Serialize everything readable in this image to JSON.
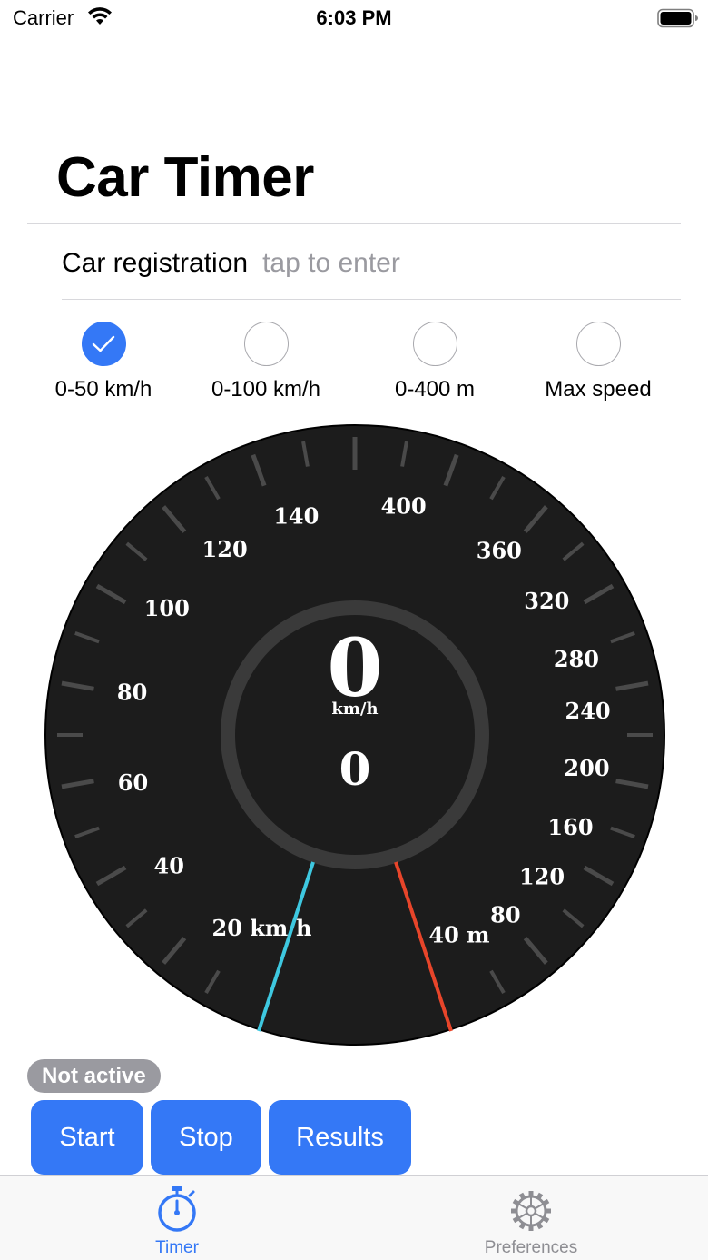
{
  "status_bar": {
    "carrier": "Carrier",
    "time": "6:03 PM"
  },
  "header": {
    "title": "Car Timer"
  },
  "registration": {
    "label": "Car registration",
    "placeholder": "tap to enter",
    "value": ""
  },
  "modes": [
    {
      "label": "0-50 km/h",
      "selected": true
    },
    {
      "label": "0-100 km/h",
      "selected": false
    },
    {
      "label": "0-400 m",
      "selected": false
    },
    {
      "label": "Max speed",
      "selected": false
    }
  ],
  "gauge": {
    "speed_labels": [
      "20",
      "40",
      "60",
      "80",
      "100",
      "120",
      "140"
    ],
    "speed_unit_label": "km/h",
    "distance_labels": [
      "40",
      "80",
      "120",
      "160",
      "200",
      "240",
      "280",
      "320",
      "360",
      "400"
    ],
    "distance_unit_label": "m",
    "speed_value": "0",
    "speed_unit": "km/h",
    "distance_value": "0",
    "speed_needle_color": "#3ec8e0",
    "distance_needle_color": "#e8452a",
    "dial_color": "#1c1c1c",
    "ring_color": "#3a3a3a"
  },
  "status": {
    "text": "Not active"
  },
  "actions": {
    "start": "Start",
    "stop": "Stop",
    "results": "Results"
  },
  "tabs": [
    {
      "label": "Timer",
      "icon": "stopwatch-icon",
      "active": true
    },
    {
      "label": "Preferences",
      "icon": "gear-icon",
      "active": false
    }
  ],
  "colors": {
    "accent": "#3478f6",
    "inactive": "#8e8e93",
    "pill": "#9a9aa0"
  }
}
